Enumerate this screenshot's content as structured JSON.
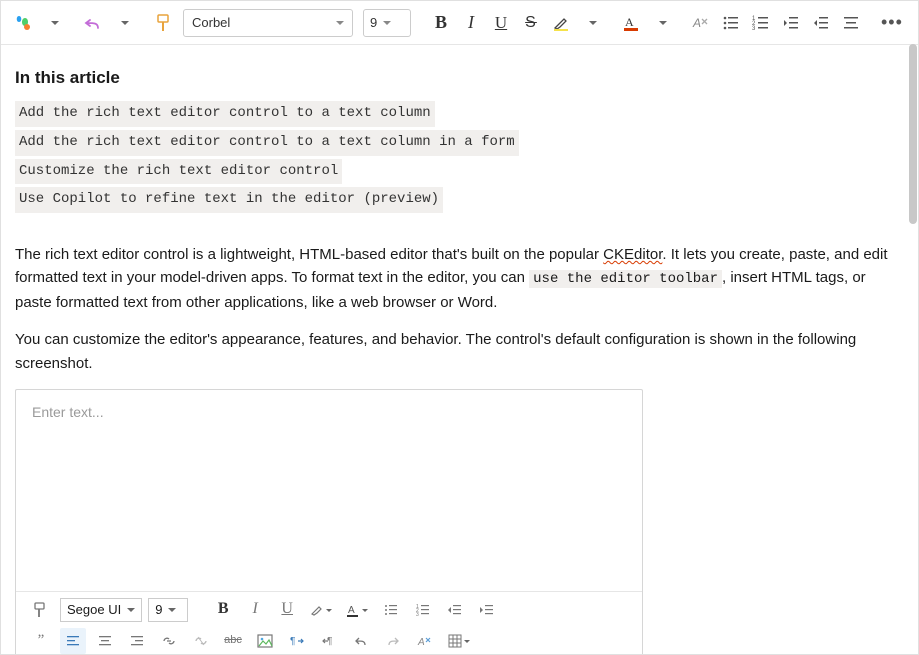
{
  "toolbar": {
    "font_name": "Corbel",
    "font_size": "9"
  },
  "article": {
    "toc_header": "In this article",
    "toc": [
      "Add the rich text editor control to a text column",
      "Add the rich text editor control to a text column in a form",
      "Customize the rich text editor control",
      "Use Copilot to refine text in the editor (preview)"
    ],
    "p1_a": "The rich text editor control is a lightweight, HTML-based editor that's built on the popular ",
    "p1_sq": "CKEditor",
    "p1_b": ". It lets you create, paste, and edit formatted text in your model-driven apps. To format text in the editor, you can ",
    "p1_code": "use the editor toolbar",
    "p1_c": ", insert HTML tags, or paste formatted text from other applications, like a web browser or Word.",
    "p2": "You can customize the editor's appearance, features, and behavior. The control's default configuration is shown in the following screenshot."
  },
  "preview": {
    "placeholder": "Enter text...",
    "font_name": "Segoe UI",
    "font_size": "9",
    "quote_glyph": "”",
    "abc": "abc"
  }
}
